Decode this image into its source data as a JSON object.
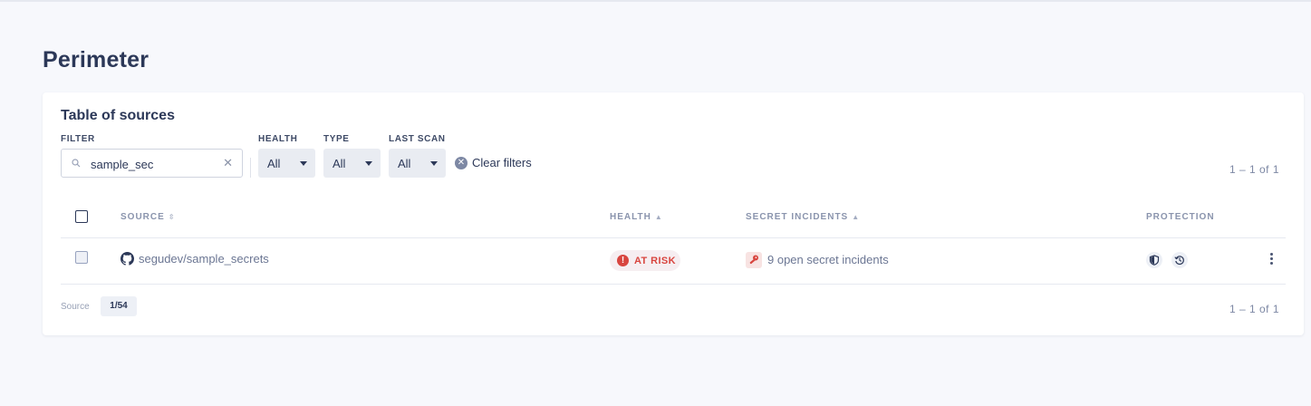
{
  "page": {
    "title": "Perimeter"
  },
  "card": {
    "title": "Table of sources",
    "filters": {
      "filter_label": "FILTER",
      "search_value": "sample_sec",
      "health_label": "HEALTH",
      "health_value": "All",
      "type_label": "TYPE",
      "type_value": "All",
      "last_scan_label": "LAST SCAN",
      "last_scan_value": "All",
      "clear_label": "Clear filters"
    },
    "pagination_top": "1 – 1  of  1",
    "pagination_bottom": "1 – 1  of  1",
    "columns": {
      "source": "SOURCE",
      "health": "HEALTH",
      "secret_incidents": "SECRET INCIDENTS",
      "protection": "PROTECTION"
    },
    "rows": [
      {
        "source": "segudev/sample_secrets",
        "source_icon": "github-icon",
        "health": "AT RISK",
        "incidents": "9 open secret incidents",
        "protection_icons": [
          "shield-icon",
          "history-icon"
        ]
      }
    ],
    "footer": {
      "label": "Source",
      "badge": "1/54"
    }
  },
  "colors": {
    "background": "#f7f8fc",
    "title": "#2c3858",
    "at_risk": "#d8453f",
    "muted": "#7d88a4"
  }
}
